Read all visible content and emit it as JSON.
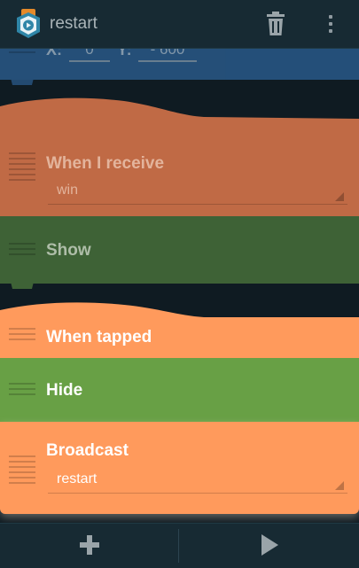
{
  "actionbar": {
    "title": "restart",
    "app_icon": "pocket-code-app-icon",
    "delete_icon": "trash-icon",
    "menu_icon": "overflow-menu-icon"
  },
  "bricks": {
    "place_at": {
      "x_label": "X:",
      "x_value": "0",
      "y_label": "Y:",
      "y_value": "- 600"
    },
    "when_receive": {
      "label": "When I receive",
      "value": "win"
    },
    "show": {
      "label": "Show"
    },
    "when_tapped": {
      "label": "When tapped"
    },
    "hide": {
      "label": "Hide"
    },
    "broadcast": {
      "label": "Broadcast",
      "value": "restart"
    }
  },
  "bottombar": {
    "add_icon": "plus-icon",
    "play_icon": "play-icon"
  },
  "colors": {
    "control_orange": "#ff9a5c",
    "looks_green": "#68a045",
    "motion_blue": "#2a5b8c",
    "dimmed_orange": "#c06a45",
    "dimmed_green": "#3e6236"
  }
}
